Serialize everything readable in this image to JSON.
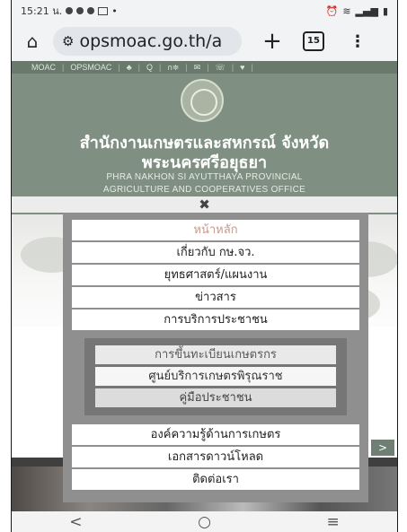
{
  "status_bar": {
    "time": "15:21 น.",
    "tabs_count": "15"
  },
  "browser": {
    "url": "opsmoac.go.th/a",
    "tune_icon": "tune-icon",
    "home_icon": "home-icon",
    "plus": "+",
    "more": "⋮"
  },
  "site": {
    "topnav": [
      "MOAC",
      "OPSMOAC",
      "♣",
      "Q",
      "ก≑",
      "✉",
      "☏",
      "♥"
    ],
    "title_th_1": "สำนักงานเกษตรและสหกรณ์ จังหวัด",
    "title_th_2": "พระนครศรีอยุธยา",
    "title_en_1": "PHRA NAKHON SI AYUTTHAYA PROVINCIAL",
    "title_en_2": "AGRICULTURE AND COOPERATIVES OFFICE"
  },
  "menu": {
    "close": "✖",
    "items": [
      "หน้าหลัก",
      "เกี่ยวกับ กษ.จว.",
      "ยุทธศาสตร์/แผนงาน",
      "ข่าวสาร",
      "การบริการประชาชน"
    ],
    "submenu": [
      "การขึ้นทะเบียนเกษตรกร",
      "ศูนย์บริการเกษตรพิรุณราช",
      "คู่มือประชาชน"
    ],
    "items_bottom": [
      "องค์ความรู้ด้านการเกษตร",
      "เอกสารดาวน์โหลด",
      "ติดต่อเรา"
    ]
  },
  "navbar": {
    "back": "<",
    "home": "○",
    "recents": "≡"
  },
  "colors": {
    "header_bg": "#7f8f82",
    "menu_panel": "#8f8f8f",
    "home_item": "#c79a8e"
  }
}
